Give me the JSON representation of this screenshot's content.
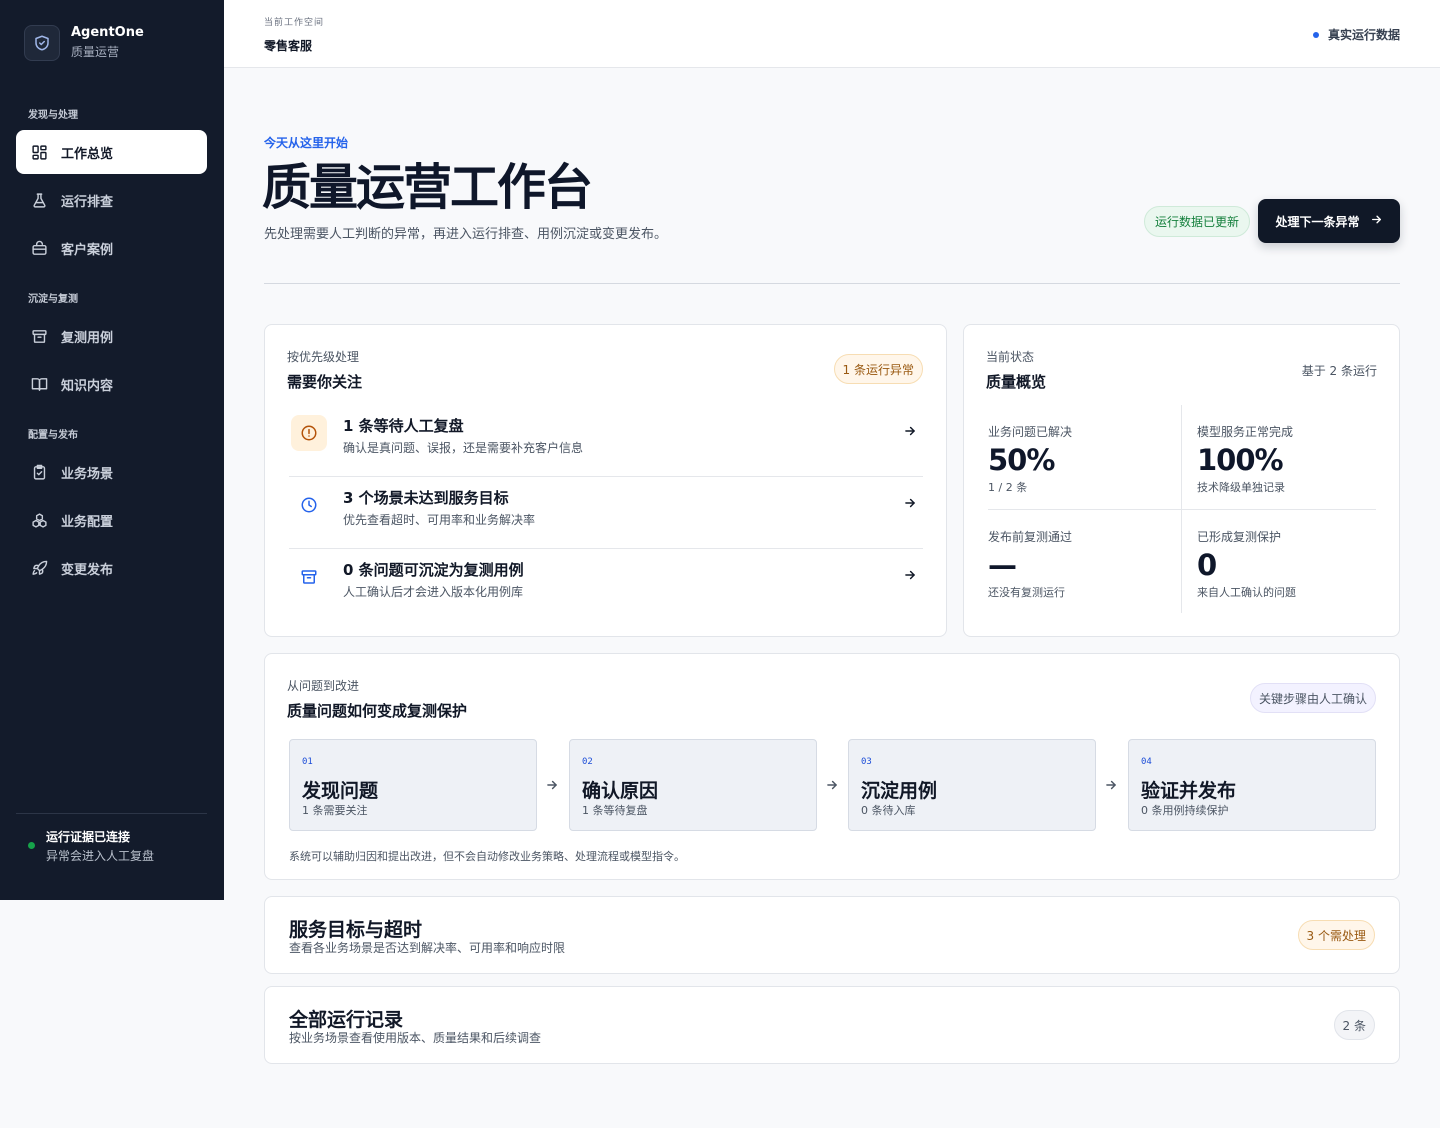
{
  "brand": {
    "name": "AgentOne",
    "subtitle": "质量运营"
  },
  "sidebar": {
    "sections": [
      {
        "label": "发现与处理"
      },
      {
        "label": "沉淀与复测"
      },
      {
        "label": "配置与发布"
      }
    ],
    "items": [
      {
        "label": "工作总览",
        "icon": "dashboard-icon"
      },
      {
        "label": "运行排查",
        "icon": "flask-icon"
      },
      {
        "label": "客户案例",
        "icon": "briefcase-icon"
      },
      {
        "label": "复测用例",
        "icon": "archive-icon"
      },
      {
        "label": "知识内容",
        "icon": "book-icon"
      },
      {
        "label": "业务场景",
        "icon": "clipboard-check-icon"
      },
      {
        "label": "业务配置",
        "icon": "boxes-icon"
      },
      {
        "label": "变更发布",
        "icon": "rocket-icon"
      }
    ],
    "footer": {
      "title": "运行证据已连接",
      "subtitle": "异常会进入人工复盘",
      "dot_color": "#16a34a"
    }
  },
  "topbar": {
    "workspace_label": "当前工作空间",
    "workspace_name": "零售客服",
    "live_label": "真实运行数据"
  },
  "hero": {
    "eyebrow": "今天从这里开始",
    "title": "质量运营工作台",
    "description": "先处理需要人工判断的异常，再进入运行排查、用例沉淀或变更发布。",
    "status_pill": "运行数据已更新",
    "primary_button": "处理下一条异常"
  },
  "attention": {
    "kicker": "按优先级处理",
    "title": "需要你关注",
    "badge": "1 条运行异常",
    "tasks": [
      {
        "title": "1 条等待人工复盘",
        "subtitle": "确认是真问题、误报，还是需要补充客户信息",
        "icon": "alert-circle-icon"
      },
      {
        "title": "3 个场景未达到服务目标",
        "subtitle": "优先查看超时、可用率和业务解决率",
        "icon": "clock-icon"
      },
      {
        "title": "0 条问题可沉淀为复测用例",
        "subtitle": "人工确认后才会进入版本化用例库",
        "icon": "archive-icon"
      }
    ]
  },
  "overview": {
    "kicker": "当前状态",
    "title": "质量概览",
    "basis": "基于 2 条运行",
    "metrics": [
      {
        "label": "业务问题已解决",
        "value": "50%",
        "sub": "1 / 2 条"
      },
      {
        "label": "模型服务正常完成",
        "value": "100%",
        "sub": "技术降级单独记录"
      },
      {
        "label": "发布前复测通过",
        "value": "—",
        "sub": "还没有复测运行"
      },
      {
        "label": "已形成复测保护",
        "value": "0",
        "sub": "来自人工确认的问题"
      }
    ]
  },
  "flow": {
    "kicker": "从问题到改进",
    "title": "质量问题如何变成复测保护",
    "badge": "关键步骤由人工确认",
    "steps": [
      {
        "num": "01",
        "title": "发现问题",
        "sub": "1 条需要关注"
      },
      {
        "num": "02",
        "title": "确认原因",
        "sub": "1 条等待复盘"
      },
      {
        "num": "03",
        "title": "沉淀用例",
        "sub": "0 条待入库"
      },
      {
        "num": "04",
        "title": "验证并发布",
        "sub": "0 条用例持续保护"
      }
    ],
    "note": "系统可以辅助归因和提出改进，但不会自动修改业务策略、处理流程或模型指令。"
  },
  "sla": {
    "title": "服务目标与超时",
    "subtitle": "查看各业务场景是否达到解决率、可用率和响应时限",
    "badge": "3 个需处理"
  },
  "runs": {
    "title": "全部运行记录",
    "subtitle": "按业务场景查看使用版本、质量结果和后续调查",
    "badge": "2 条"
  },
  "colors": {
    "accent": "#2563eb",
    "sidebar_bg": "#131b2b",
    "warn": "#d97706",
    "success": "#16a34a"
  }
}
